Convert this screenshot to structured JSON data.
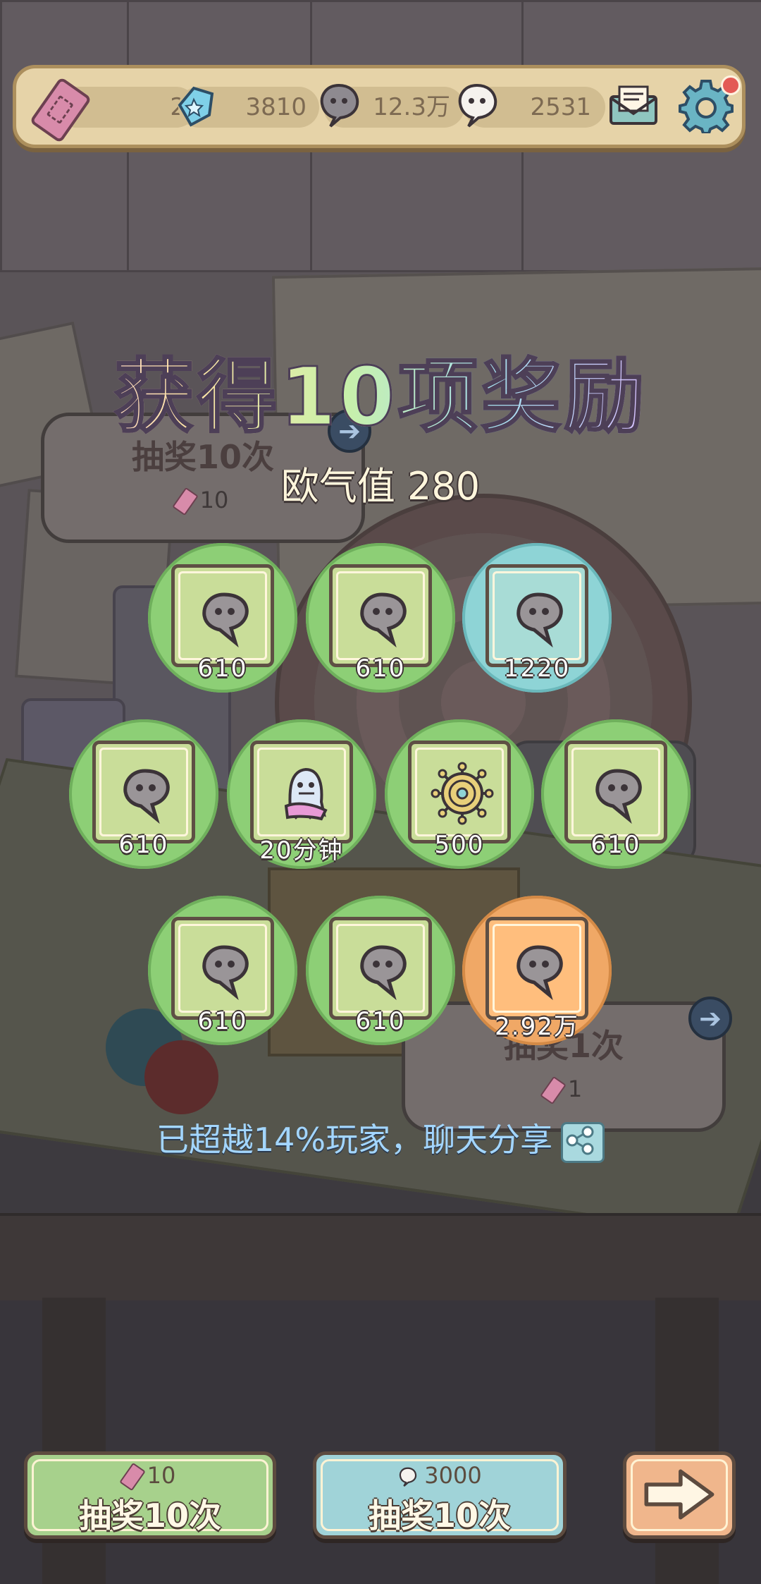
{
  "currency_bar": {
    "tickets": "2",
    "gems": "3810",
    "dark_souls": "12.3万",
    "white_souls": "2531"
  },
  "background": {
    "draw10_label": "抽奖10次",
    "draw10_cost": "10",
    "draw1_label": "抽奖1次",
    "draw1_cost": "1"
  },
  "result": {
    "title": "获得10项奖励",
    "luck_text": "欧气值 280",
    "rewards": [
      {
        "type": "dark-soul",
        "count": "610",
        "rarity": "green"
      },
      {
        "type": "dark-soul",
        "count": "610",
        "rarity": "green"
      },
      {
        "type": "dark-soul",
        "count": "1220",
        "rarity": "blue"
      },
      {
        "type": "dark-soul",
        "count": "610",
        "rarity": "green"
      },
      {
        "type": "ghost-costume",
        "count": "20分钟",
        "rarity": "green"
      },
      {
        "type": "virus-coin",
        "count": "500",
        "rarity": "green"
      },
      {
        "type": "dark-soul",
        "count": "610",
        "rarity": "green"
      },
      {
        "type": "dark-soul",
        "count": "610",
        "rarity": "green"
      },
      {
        "type": "dark-soul",
        "count": "610",
        "rarity": "green"
      },
      {
        "type": "dark-soul",
        "count": "2.92万",
        "rarity": "orange"
      }
    ],
    "share_text": "已超越14%玩家，聊天分享"
  },
  "buttons": {
    "ticket_draw": {
      "cost": "10",
      "label": "抽奖10次"
    },
    "soul_draw": {
      "cost": "3000",
      "label": "抽奖10次"
    }
  },
  "colors": {
    "rarity_green": "#8dcf76",
    "rarity_blue": "#8ed4d6",
    "rarity_orange": "#f0a866",
    "share_text": "#a3d6ff"
  }
}
